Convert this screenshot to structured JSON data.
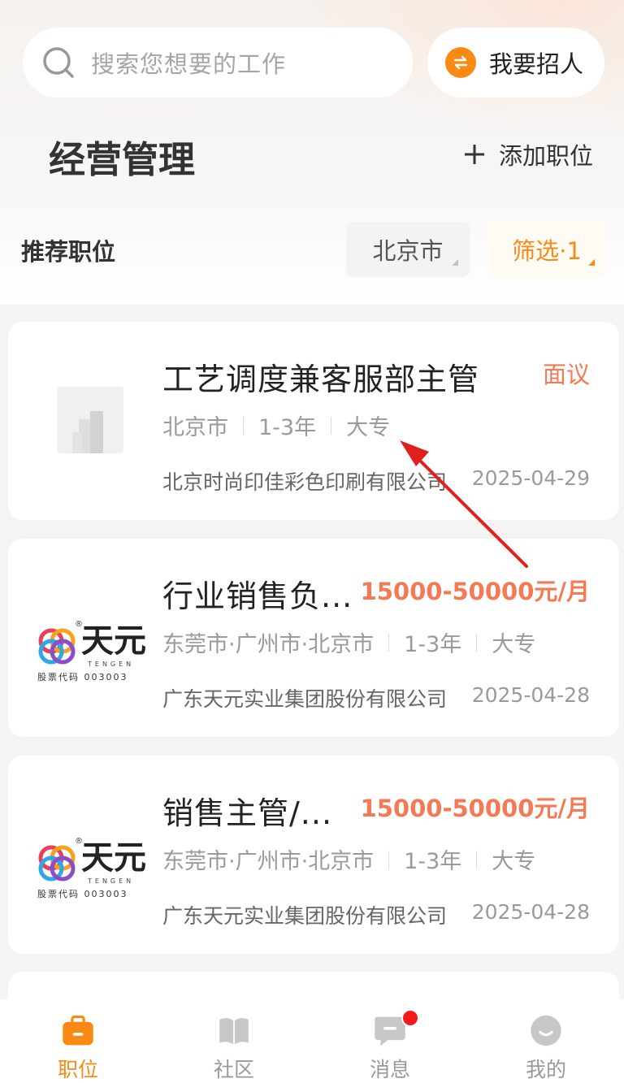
{
  "header": {
    "search_placeholder": "搜索您想要的工作",
    "recruit_label": "我要招人",
    "section_title": "经营管理",
    "add_position_label": "添加职位"
  },
  "filters": {
    "recommend_label": "推荐职位",
    "city": "北京市",
    "screen_label": "筛选·1"
  },
  "jobs": [
    {
      "title": "工艺调度兼客服部主管",
      "salary": "面议",
      "location": "北京市",
      "experience": "1-3年",
      "education": "大专",
      "company": "北京时尚印佳彩色印刷有限公司",
      "date": "2025-04-29"
    },
    {
      "title": "行业销售负...",
      "salary": "15000-50000元/月",
      "location": "东莞市·广州市·北京市",
      "experience": "1-3年",
      "education": "大专",
      "company": "广东天元实业集团股份有限公司",
      "date": "2025-04-28",
      "logo": {
        "brand": "天元",
        "brand_en": "TENGEN",
        "stock_code": "股票代码 003003"
      }
    },
    {
      "title": "销售主管/...",
      "salary": "15000-50000元/月",
      "location": "东莞市·广州市·北京市",
      "experience": "1-3年",
      "education": "大专",
      "company": "广东天元实业集团股份有限公司",
      "date": "2025-04-28",
      "logo": {
        "brand": "天元",
        "brand_en": "TENGEN",
        "stock_code": "股票代码 003003"
      }
    }
  ],
  "nav": {
    "items": [
      {
        "label": "职位",
        "icon": "briefcase-icon",
        "active": true
      },
      {
        "label": "社区",
        "icon": "book-icon",
        "active": false
      },
      {
        "label": "消息",
        "icon": "chat-icon",
        "active": false,
        "badge": true
      },
      {
        "label": "我的",
        "icon": "profile-icon",
        "active": false
      }
    ]
  },
  "colors": {
    "accent": "#fb8a14",
    "salary": "#f37a54",
    "badge": "#f41a1a",
    "annotation_arrow": "#e0201c"
  }
}
